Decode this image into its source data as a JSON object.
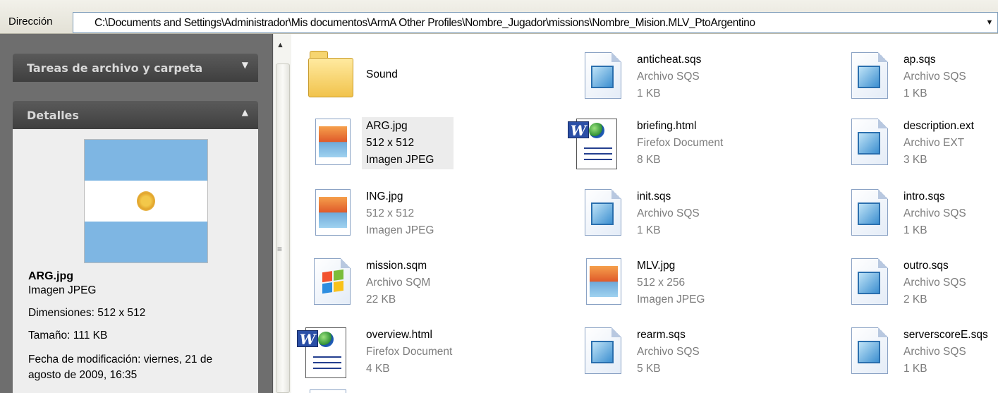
{
  "address_bar": {
    "label": "Dirección",
    "path": "C:\\Documents and Settings\\Administrador\\Mis documentos\\ArmA Other Profiles\\Nombre_Jugador\\missions\\Nombre_Mision.MLV_PtoArgentino"
  },
  "task_pane": {
    "file_tasks_header": "Tareas de archivo y carpeta",
    "details_header": "Detalles",
    "details": {
      "name": "ARG.jpg",
      "type": "Imagen JPEG",
      "dimensions": "Dimensiones: 512 x 512",
      "size": "Tamaño: 111 KB",
      "modified": "Fecha de modificación: viernes, 21 de agosto de 2009, 16:35"
    }
  },
  "files": [
    {
      "name": "Sound",
      "line2": "",
      "line3": "",
      "icon": "folder-icon"
    },
    {
      "name": "anticheat.sqs",
      "line2": "Archivo SQS",
      "line3": "1 KB",
      "icon": "sqs-file-icon"
    },
    {
      "name": "ap.sqs",
      "line2": "Archivo SQS",
      "line3": "1 KB",
      "icon": "sqs-file-icon"
    },
    {
      "name": "ARG.jpg",
      "line2": "512 x 512",
      "line3": "Imagen JPEG",
      "icon": "jpeg-file-icon"
    },
    {
      "name": "briefing.html",
      "line2": "Firefox Document",
      "line3": "8 KB",
      "icon": "word-html-icon"
    },
    {
      "name": "description.ext",
      "line2": "Archivo EXT",
      "line3": "3 KB",
      "icon": "ext-file-icon"
    },
    {
      "name": "ING.jpg",
      "line2": "512 x 512",
      "line3": "Imagen JPEG",
      "icon": "jpeg-file-icon"
    },
    {
      "name": "init.sqs",
      "line2": "Archivo SQS",
      "line3": "1 KB",
      "icon": "sqs-file-icon"
    },
    {
      "name": "intro.sqs",
      "line2": "Archivo SQS",
      "line3": "1 KB",
      "icon": "sqs-file-icon"
    },
    {
      "name": "mission.sqm",
      "line2": "Archivo SQM",
      "line3": "22 KB",
      "icon": "windows-file-icon"
    },
    {
      "name": "MLV.jpg",
      "line2": "512 x 256",
      "line3": "Imagen JPEG",
      "icon": "jpeg-file-icon"
    },
    {
      "name": "outro.sqs",
      "line2": "Archivo SQS",
      "line3": "2 KB",
      "icon": "sqs-file-icon"
    },
    {
      "name": "overview.html",
      "line2": "Firefox Document",
      "line3": "4 KB",
      "icon": "word-html-icon"
    },
    {
      "name": "rearm.sqs",
      "line2": "Archivo SQS",
      "line3": "5 KB",
      "icon": "sqs-file-icon"
    },
    {
      "name": "serverscoreE.sqs",
      "line2": "Archivo SQS",
      "line3": "1 KB",
      "icon": "sqs-file-icon"
    }
  ]
}
